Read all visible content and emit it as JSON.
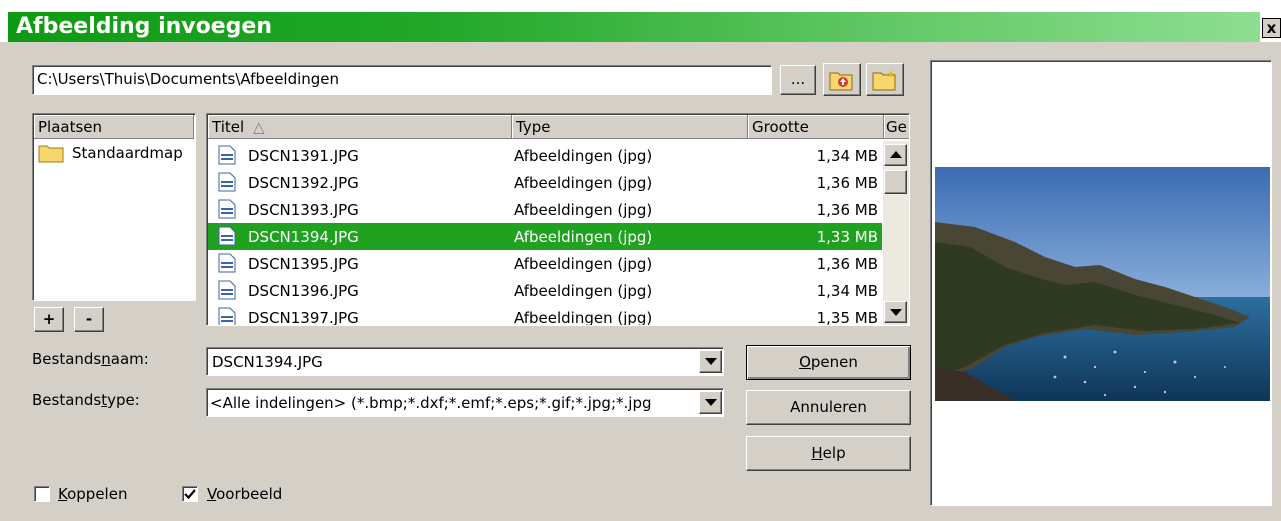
{
  "window": {
    "title": "Afbeelding invoegen",
    "close_label": "x"
  },
  "path": {
    "value": "C:\\Users\\Thuis\\Documents\\Afbeeldingen",
    "browse_label": "..."
  },
  "places": {
    "header": "Plaatsen",
    "items": [
      {
        "label": "Standaardmap"
      }
    ],
    "add_label": "+",
    "remove_label": "-"
  },
  "file_list": {
    "columns": {
      "title": "Titel",
      "sort_indicator": "△",
      "type": "Type",
      "size": "Grootte",
      "date": "Ge"
    },
    "rows": [
      {
        "name": "DSCN1391.JPG",
        "type": "Afbeeldingen (jpg)",
        "size": "1,34 MB",
        "selected": false
      },
      {
        "name": "DSCN1392.JPG",
        "type": "Afbeeldingen (jpg)",
        "size": "1,36 MB",
        "selected": false
      },
      {
        "name": "DSCN1393.JPG",
        "type": "Afbeeldingen (jpg)",
        "size": "1,36 MB",
        "selected": false
      },
      {
        "name": "DSCN1394.JPG",
        "type": "Afbeeldingen (jpg)",
        "size": "1,33 MB",
        "selected": true
      },
      {
        "name": "DSCN1395.JPG",
        "type": "Afbeeldingen (jpg)",
        "size": "1,36 MB",
        "selected": false
      },
      {
        "name": "DSCN1396.JPG",
        "type": "Afbeeldingen (jpg)",
        "size": "1,34 MB",
        "selected": false
      },
      {
        "name": "DSCN1397.JPG",
        "type": "Afbeeldingen (jpg)",
        "size": "1,35 MB",
        "selected": false
      }
    ]
  },
  "filename": {
    "label_pre": "Bestands",
    "label_u": "n",
    "label_post": "aam:",
    "value": "DSCN1394.JPG"
  },
  "filetype": {
    "label_pre": "Bestands",
    "label_u": "t",
    "label_post": "ype:",
    "value": "<Alle indelingen> (*.bmp;*.dxf;*.emf;*.eps;*.gif;*.jpg;*.jpg"
  },
  "buttons": {
    "open_u": "O",
    "open_rest": "penen",
    "cancel": "Annuleren",
    "help_u": "H",
    "help_rest": "elp"
  },
  "options": {
    "link_u": "K",
    "link_rest": "oppelen",
    "link_checked": false,
    "preview_u": "V",
    "preview_rest": "oorbeeld",
    "preview_checked": true
  },
  "colors": {
    "selection": "#20a120",
    "title_gradient_start": "#0e9a12",
    "title_gradient_end": "#8ede92",
    "folder": "#f7d66b"
  }
}
